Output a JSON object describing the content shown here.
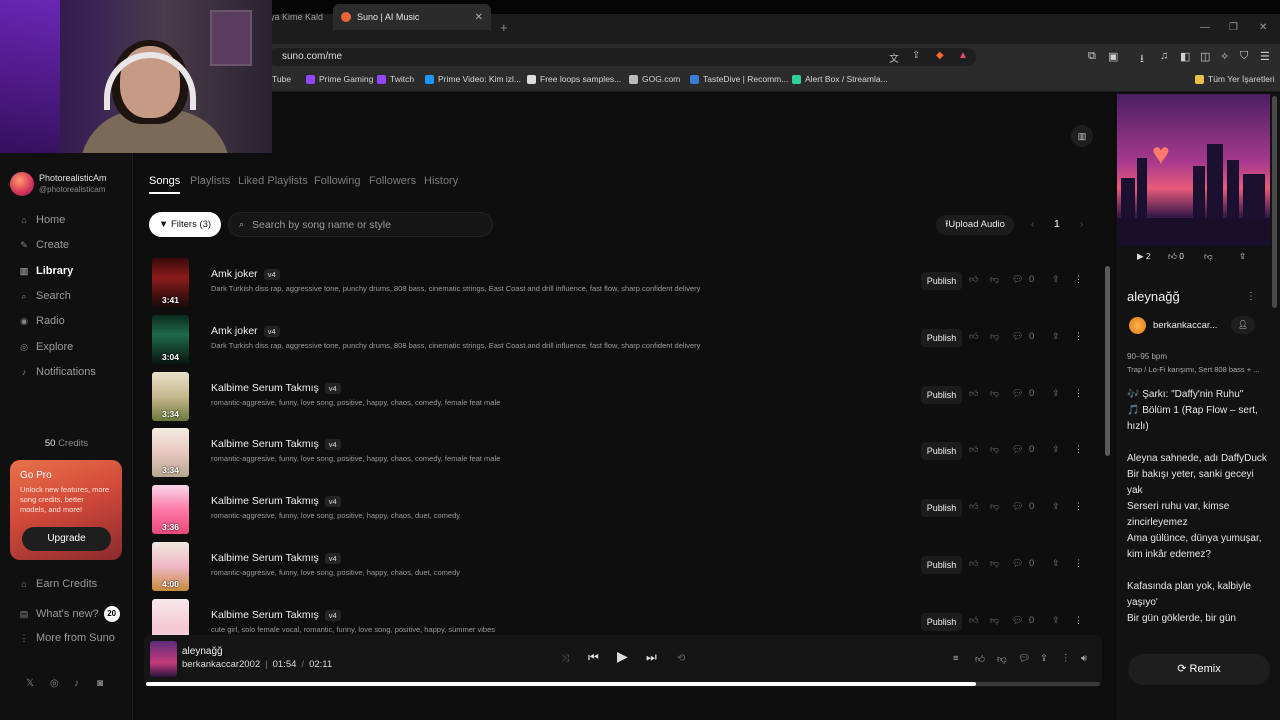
{
  "browser": {
    "tab_inactive": "ya Kime Kald",
    "tab_active": "Suno | AI Music",
    "url": "suno.com/me",
    "bookmarks": [
      {
        "label": "Tube",
        "color": "#e02020"
      },
      {
        "label": "Prime Gaming",
        "color": "#9146ff"
      },
      {
        "label": "Twitch",
        "color": "#9146ff"
      },
      {
        "label": "Prime Video: Kim izl...",
        "color": "#1a98ff"
      },
      {
        "label": "Free loops samples...",
        "color": "#dddddd"
      },
      {
        "label": "GOG.com",
        "color": "#bbbbbb"
      },
      {
        "label": "TasteDive | Recomm...",
        "color": "#3a7bd5"
      },
      {
        "label": "Alert Box / Streamla...",
        "color": "#30d0a0"
      }
    ],
    "all_bookmarks": "Tüm Yer İşaretleri"
  },
  "sidebar": {
    "profile_name": "PhotorealisticAm",
    "profile_handle": "@photorealisticam",
    "nav": [
      {
        "label": "Home",
        "icon": "home-icon",
        "glyph": "⌂",
        "active": false
      },
      {
        "label": "Create",
        "icon": "create-icon",
        "glyph": "✎",
        "active": false
      },
      {
        "label": "Library",
        "icon": "library-icon",
        "glyph": "▥",
        "active": true
      },
      {
        "label": "Search",
        "icon": "search-icon",
        "glyph": "⌕",
        "active": false
      },
      {
        "label": "Radio",
        "icon": "radio-icon",
        "glyph": "◉",
        "active": false
      },
      {
        "label": "Explore",
        "icon": "explore-icon",
        "glyph": "◎",
        "active": false
      },
      {
        "label": "Notifications",
        "icon": "bell-icon",
        "glyph": "♪",
        "active": false
      }
    ],
    "credits_value": "50",
    "credits_label": "Credits",
    "gopro_title": "Go Pro",
    "gopro_text": "Unlock new features, more song credits, better models, and more!",
    "upgrade": "Upgrade",
    "earn_credits": "Earn Credits",
    "whats_new": "What's new?",
    "whats_new_count": "20",
    "more_from": "More from Suno"
  },
  "library": {
    "tabs": [
      "Songs",
      "Playlists",
      "Liked Playlists",
      "Following",
      "Followers",
      "History"
    ],
    "filters": "Filters (3)",
    "search_placeholder": "Search by song name or style",
    "upload": "Upload Audio",
    "page": "1",
    "publish_label": "Publish",
    "songs": [
      {
        "title": "Amk joker",
        "version": "v4",
        "desc": "Dark Turkish diss rap, aggressive tone, punchy drums, 808 bass, cinematic strings, East Coast and drill influence, fast flow, sharp confident delivery",
        "duration": "3:41",
        "comments": "0",
        "thumb": "linear-gradient(180deg,#3a0a0a,#8a1a1a 40%,#1a0a0a)"
      },
      {
        "title": "Amk joker",
        "version": "v4",
        "desc": "Dark Turkish diss rap, aggressive tone, punchy drums, 808 bass, cinematic strings, East Coast and drill influence, fast flow, sharp confident delivery",
        "duration": "3:04",
        "comments": "0",
        "thumb": "linear-gradient(180deg,#0a2a1e,#1e6a4a 40%,#0a1410)"
      },
      {
        "title": "Kalbime Serum Takmış",
        "version": "v4",
        "desc": "romantic-aggresive, funny, love song, positive, happy, chaos, comedy, female feat male",
        "duration": "3:34",
        "comments": "0",
        "thumb": "linear-gradient(180deg,#e8e0c8,#c8b890 50%,#6a7a3a)"
      },
      {
        "title": "Kalbime Serum Takmış",
        "version": "v4",
        "desc": "romantic-aggresive, funny, love song, positive, happy, chaos, comedy, female feat male",
        "duration": "3:34",
        "comments": "0",
        "thumb": "linear-gradient(180deg,#f2ece0,#e8c8c0 50%,#b8a890)"
      },
      {
        "title": "Kalbime Serum Takmış",
        "version": "v4",
        "desc": "romantic-aggresive, funny, love song, positive, happy, chaos, duet, comedy",
        "duration": "3:36",
        "comments": "0",
        "thumb": "linear-gradient(180deg,#f8d8e8,#ff7aa8 50%,#e84a7a)"
      },
      {
        "title": "Kalbime Serum Takmış",
        "version": "v4",
        "desc": "romantic-aggresive, funny, love song, positive, happy, chaos, duet, comedy",
        "duration": "4:00",
        "comments": "0",
        "thumb": "linear-gradient(180deg,#f0e8e0,#f0b8c8 50%,#c88a3a)"
      },
      {
        "title": "Kalbime Serum Takmış",
        "version": "v4",
        "desc": "cute girl, solo female vocal, romantic, funny, love song, positive, happy, summer vibes",
        "duration": "",
        "comments": "0",
        "thumb": "linear-gradient(180deg,#f8e8ec,#f4c8d4 60%,#f0e0e4)"
      }
    ]
  },
  "player": {
    "title": "aleynağğ",
    "artist": "berkankaccar2002",
    "current_time": "01:54",
    "separator": "/",
    "total_time": "02:11",
    "progress": 0.87
  },
  "right_panel": {
    "plays": "2",
    "likes": "0",
    "title": "aleynağğ",
    "user": "berkankaccar...",
    "bpm": "90–95 bpm",
    "style": "Trap / Lo-Fi karışımı, Sert 808 bass + ...",
    "lyrics": [
      "🎶 Şarkı: \"Daffy'nin Ruhu\"\n🎵 Bölüm 1 (Rap Flow – sert, hızlı)",
      "Aleyna sahnede, adı DaffyDuck\nBir bakışı yeter, sanki geceyi yak\nSerseri ruhu var, kimse zincirleyemez\nAma gülünce, dünya yumuşar, kim inkâr edemez?",
      "Kafasında plan yok, kalbiyle yaşıyo'\nBir gün göklerde, bir gün"
    ],
    "remix": "Remix"
  }
}
